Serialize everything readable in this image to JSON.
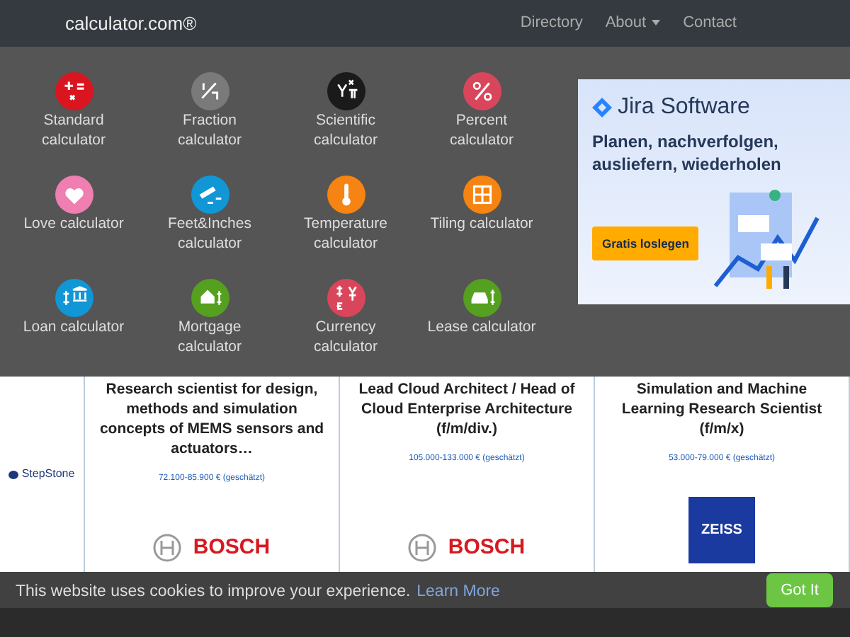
{
  "navbar": {
    "brand": "calculator.com®",
    "links": [
      {
        "label": "Directory",
        "dropdown": false
      },
      {
        "label": "About",
        "dropdown": true
      },
      {
        "label": "Contact",
        "dropdown": false
      }
    ]
  },
  "calculators": [
    {
      "label": "Standard calculator",
      "kind": "operators",
      "color": "#d9161f"
    },
    {
      "label": "Fraction calculator",
      "kind": "fraction",
      "color": "#7a7a7a"
    },
    {
      "label": "Scientific calculator",
      "kind": "power",
      "color": "#1a1a1a"
    },
    {
      "label": "Percent calculator",
      "kind": "percent",
      "color": "#d9465b"
    },
    {
      "label": "Love calculator",
      "kind": "heart",
      "color": "#ee7fb0"
    },
    {
      "label": "Feet&Inches calculator",
      "kind": "ruler",
      "color": "#1196d6"
    },
    {
      "label": "Temperature calculator",
      "kind": "thermometer",
      "color": "#f58412"
    },
    {
      "label": "Tiling calculator",
      "kind": "grid",
      "color": "#f58412"
    },
    {
      "label": "Loan calculator",
      "kind": "bank",
      "color": "#1196d6"
    },
    {
      "label": "Mortgage calculator",
      "kind": "house",
      "color": "#55a01e"
    },
    {
      "label": "Currency calculator",
      "kind": "money",
      "color": "#d9465b"
    },
    {
      "label": "Lease calculator",
      "kind": "car",
      "color": "#55a01e"
    }
  ],
  "side_ad": {
    "title": "Jira Software",
    "text": "Planen, nachverfolgen, ausliefern, wiederholen",
    "button": "Gratis loslegen"
  },
  "job_ad": {
    "brand": "StepStone",
    "jobs": [
      {
        "title": "Research scientist for design, methods and simulation concepts of MEMS sensors and actuators…",
        "salary": "72.100-85.900 € (geschätzt)",
        "logo": "BOSCH",
        "kind": "bosch"
      },
      {
        "title": "Lead Cloud Architect / Head of Cloud Enterprise Architecture (f/m/div.)",
        "salary": "105.000-133.000 € (geschätzt)",
        "logo": "BOSCH",
        "kind": "bosch"
      },
      {
        "title": "Simulation and Machine Learning Research Scientist (f/m/x)",
        "salary": "53.000-79.000 € (geschätzt)",
        "logo": "ZEISS",
        "kind": "zeiss"
      }
    ]
  },
  "cookie_bar": {
    "text": "This website uses cookies to improve your experience.",
    "link": "Learn More",
    "button": "Got It"
  }
}
